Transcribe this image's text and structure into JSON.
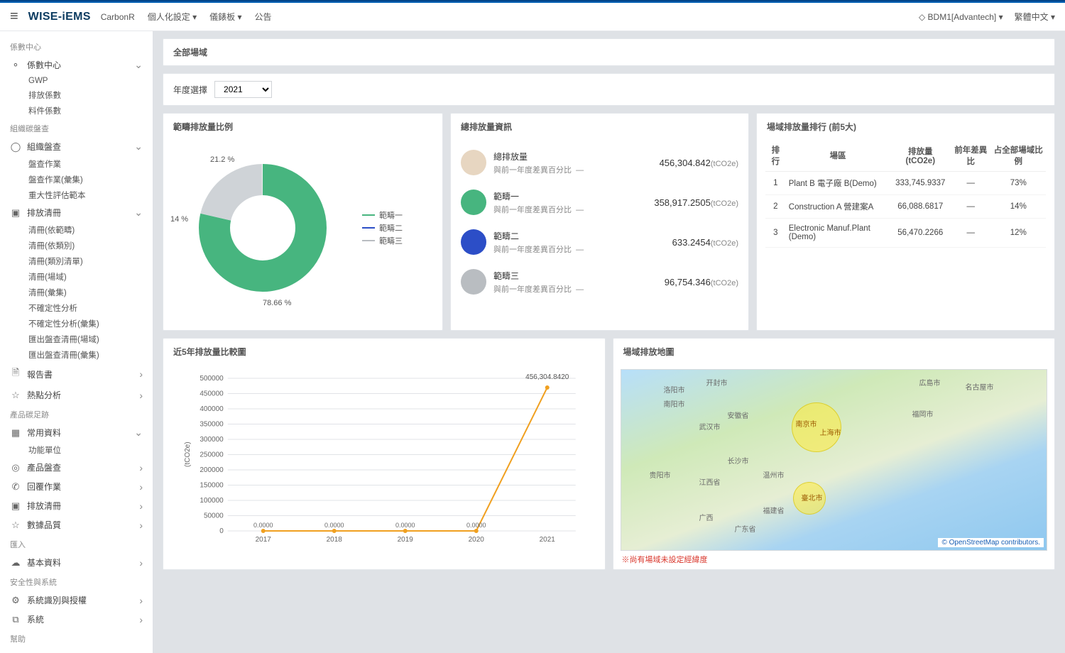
{
  "topbar": {
    "logo": "WISE-iEMS",
    "context": "CarbonR",
    "nav_personal": "個人化設定",
    "nav_dashboard": "儀錶板",
    "nav_notice": "公告",
    "user_label": "BDM1[Advantech]",
    "lang": "繁體中文"
  },
  "page_title": "全部場域",
  "filter": {
    "label": "年度選擇",
    "year": "2021"
  },
  "sidebar": {
    "sec_coef": "係數中心",
    "coef_center": "係數中心",
    "coef_gwp": "GWP",
    "coef_emit": "排放係數",
    "coef_material": "料件係數",
    "sec_org": "組織碳盤查",
    "org_check": "組織盤查",
    "check_job": "盤查作業",
    "check_job_collect": "盤查作業(彙集)",
    "sig_template": "重大性評估範本",
    "emit_list": "排放清冊",
    "list_by_scope": "清冊(依範疇)",
    "list_by_type": "清冊(依類別)",
    "list_type_menu": "清冊(類別清單)",
    "list_site": "清冊(場域)",
    "list_collect": "清冊(彙集)",
    "uncertainty": "不確定性分析",
    "uncertainty_collect": "不確定性分析(彙集)",
    "export_site": "匯出盤查清冊(場域)",
    "export_collect": "匯出盤查清冊(彙集)",
    "report": "報告書",
    "hotspot": "熱點分析",
    "sec_footprint": "產品碳足跡",
    "common_data": "常用資料",
    "func_unit": "功能單位",
    "product_check": "產品盤查",
    "reply_job": "回覆作業",
    "emit_list2": "排放清冊",
    "data_quality": "數據品質",
    "sec_import": "匯入",
    "basic_data": "基本資料",
    "sec_security": "安全性與系統",
    "role_auth": "系統識別與授權",
    "system": "系統",
    "sec_help": "幫助"
  },
  "donut": {
    "title": "範疇排放量比例",
    "p1_label": "21.2 %",
    "p2_label": "14 %",
    "p3_label": "78.66 %",
    "legend1": "範疇一",
    "legend2": "範疇二",
    "legend3": "範疇三"
  },
  "totals": {
    "title": "總排放量資訊",
    "diff_label": "與前一年度差異百分比",
    "dash": "—",
    "rows": [
      {
        "name": "總排放量",
        "value": "456,304.842",
        "unit": "(tCO2e)"
      },
      {
        "name": "範疇一",
        "value": "358,917.2505",
        "unit": "(tCO2e)"
      },
      {
        "name": "範疇二",
        "value": "633.2454",
        "unit": "(tCO2e)"
      },
      {
        "name": "範疇三",
        "value": "96,754.346",
        "unit": "(tCO2e)"
      }
    ]
  },
  "rank": {
    "title": "場域排放量排行 (前5大)",
    "h_rank": "排行",
    "h_site": "場區",
    "h_emit": "排放量 (tCO2e)",
    "h_diff": "前年差異比",
    "h_share": "占全部場域比例",
    "rows": [
      {
        "rank": "1",
        "site": "Plant B 電子廠 B(Demo)",
        "emit": "333,745.9337",
        "diff": "—",
        "share": "73%"
      },
      {
        "rank": "2",
        "site": "Construction A 營建案A",
        "emit": "66,088.6817",
        "diff": "—",
        "share": "14%"
      },
      {
        "rank": "3",
        "site": "Electronic Manuf.Plant (Demo)",
        "emit": "56,470.2266",
        "diff": "—",
        "share": "12%"
      }
    ]
  },
  "trend": {
    "title": "近5年排放量比較圖",
    "ylabel": "(tCO2e)",
    "point_label": "456,304.8420",
    "zero": "0.0000"
  },
  "map": {
    "title": "場域排放地圖",
    "attr": "© OpenStreetMap contributors.",
    "warn": "※尚有場域未設定經緯度"
  },
  "chart_data": [
    {
      "type": "pie",
      "title": "範疇排放量比例",
      "series": [
        {
          "name": "範疇一",
          "value": 78.66
        },
        {
          "name": "範疇三",
          "value": 21.2
        },
        {
          "name": "範疇二",
          "value": 14
        }
      ],
      "note": "Displayed percentages do not sum to 100 in source screenshot; reproduced verbatim."
    },
    {
      "type": "line",
      "title": "近5年排放量比較圖",
      "ylabel": "(tCO2e)",
      "x": [
        "2017",
        "2018",
        "2019",
        "2020",
        "2021"
      ],
      "values": [
        0,
        0,
        0,
        0,
        456304.842
      ],
      "ylim": [
        0,
        500000
      ]
    },
    {
      "type": "table",
      "title": "場域排放量排行 (前5大)",
      "columns": [
        "排行",
        "場區",
        "排放量 (tCO2e)",
        "前年差異比",
        "占全部場域比例"
      ],
      "rows": [
        [
          "1",
          "Plant B 電子廠 B(Demo)",
          "333,745.9337",
          "—",
          "73%"
        ],
        [
          "2",
          "Construction A 營建案A",
          "66,088.6817",
          "—",
          "14%"
        ],
        [
          "3",
          "Electronic Manuf.Plant (Demo)",
          "56,470.2266",
          "—",
          "12%"
        ]
      ]
    }
  ]
}
